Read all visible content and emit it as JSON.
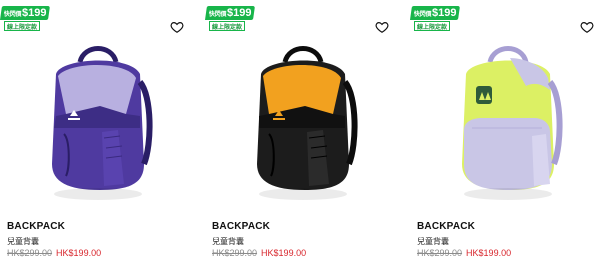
{
  "products": [
    {
      "name": "BACKPACK",
      "subtitle": "兒童背囊",
      "original_price": "HK$299.00",
      "sale_price": "HK$199.00",
      "badge": {
        "prefix": "快閃價",
        "price": "$199",
        "note": "線上限定款"
      },
      "colors": {
        "body": "#4f3aa0",
        "panel": "#b8b0e0",
        "trim": "#2a1e66"
      }
    },
    {
      "name": "BACKPACK",
      "subtitle": "兒童背囊",
      "original_price": "HK$299.00",
      "sale_price": "HK$199.00",
      "badge": {
        "prefix": "快閃價",
        "price": "$199",
        "note": "線上限定款"
      },
      "colors": {
        "body": "#1c1c1c",
        "panel": "#f2a11f",
        "trim": "#0c0c0c"
      }
    },
    {
      "name": "BACKPACK",
      "subtitle": "兒童背囊",
      "original_price": "HK$299.00",
      "sale_price": "HK$199.00",
      "badge": {
        "prefix": "快閃價",
        "price": "$199",
        "note": "線上限定款"
      },
      "colors": {
        "body": "#dcf064",
        "panel": "#c9c6e6",
        "trim": "#a79fd3"
      }
    }
  ],
  "icons": {
    "wishlist": "heart-outline-icon"
  },
  "colors": {
    "badge_green": "#18b54a",
    "sale_red": "#d8262d",
    "strike_grey": "#8b8b8b"
  }
}
